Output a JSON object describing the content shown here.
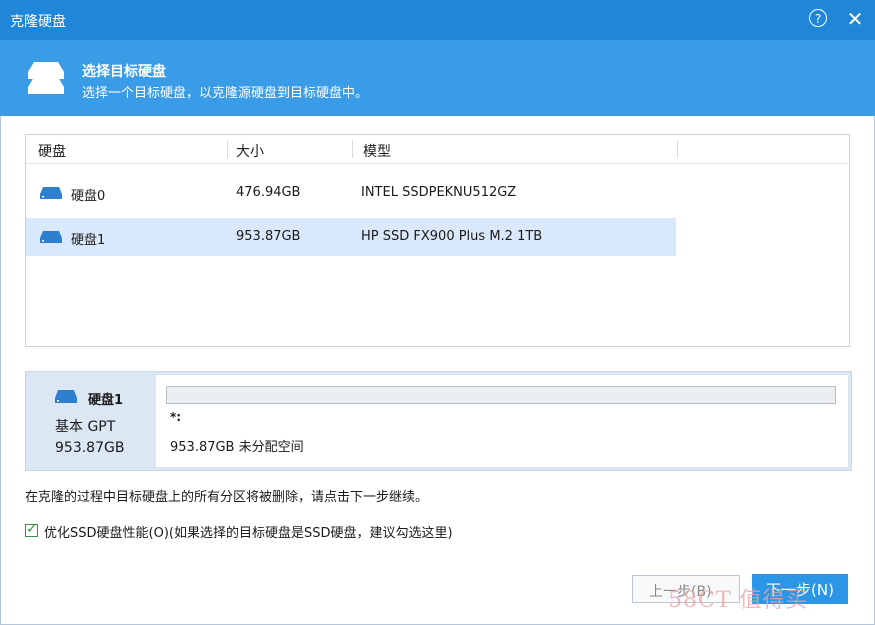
{
  "window": {
    "title": "克隆硬盘",
    "help_glyph": "?",
    "close_glyph": "✕"
  },
  "header": {
    "title": "选择目标硬盘",
    "subtitle": "选择一个目标硬盘，以克隆源硬盘到目标硬盘中。",
    "icon": "disks-icon"
  },
  "table": {
    "columns": [
      "硬盘",
      "大小",
      "模型"
    ],
    "rows": [
      {
        "name": "硬盘0",
        "size": "476.94GB",
        "model": "INTEL SSDPEKNU512GZ",
        "selected": false
      },
      {
        "name": "硬盘1",
        "size": "953.87GB",
        "model": "HP SSD FX900 Plus M.2 1TB",
        "selected": true
      }
    ]
  },
  "detail": {
    "disk_name": "硬盘1",
    "disk_type": "基本 GPT",
    "disk_size": "953.87GB",
    "partition_label": "*:",
    "partition_info": "953.87GB 未分配空间"
  },
  "warning_text": "在克隆的过程中目标硬盘上的所有分区将被删除，请点击下一步继续。",
  "optimize": {
    "checked": true,
    "label": "优化SSD硬盘性能(O)(如果选择的目标硬盘是SSD硬盘，建议勾选这里)"
  },
  "buttons": {
    "back": "上一步(B)",
    "next": "下一步(N)"
  },
  "watermark": "58CT 值得买",
  "colors": {
    "titlebar": "#1f86d8",
    "banner": "#3a9be6",
    "selected_row": "#d9e8fb",
    "primary_button": "#2b95e6"
  }
}
